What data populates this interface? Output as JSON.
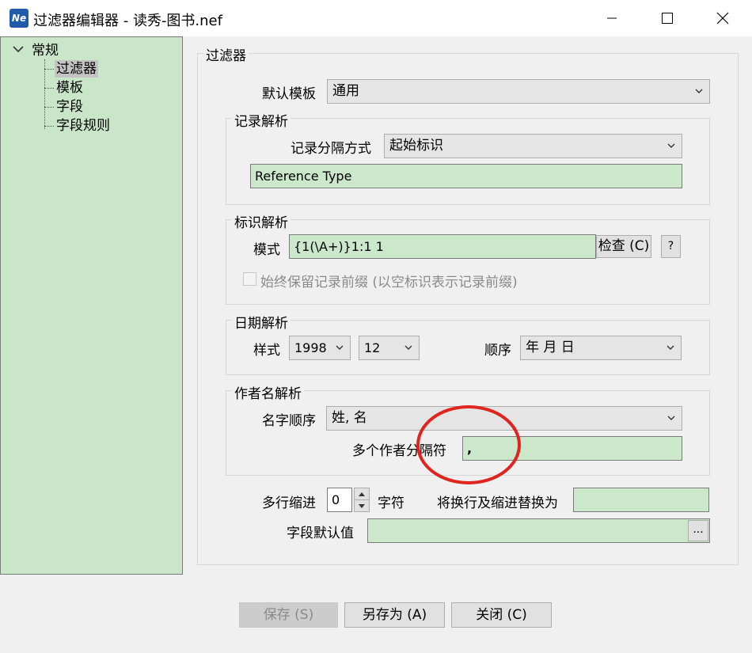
{
  "window": {
    "title": "过滤器编辑器 - 读秀-图书.nef",
    "icon_text": "Ne"
  },
  "tree": {
    "root_label": "常规",
    "items": [
      "过滤器",
      "模板",
      "字段",
      "字段规则"
    ]
  },
  "main": {
    "group_title": "过滤器",
    "default_template": {
      "label": "默认模板",
      "value": "通用"
    },
    "record_parse": {
      "title": "记录解析",
      "separator_label": "记录分隔方式",
      "separator_value": "起始标识",
      "field_value": "Reference Type"
    },
    "tag_parse": {
      "title": "标识解析",
      "mode_label": "模式",
      "mode_value": "{1(\\A+)}1:1 1",
      "check_button": "检查 (C)",
      "help_button": "?",
      "keep_prefix_label": "始终保留记录前缀 (以空标识表示记录前缀)"
    },
    "date_parse": {
      "title": "日期解析",
      "style_label": "样式",
      "year_value": "1998",
      "month_value": "12",
      "order_label": "顺序",
      "order_value": "年 月 日"
    },
    "author_parse": {
      "title": "作者名解析",
      "name_order_label": "名字顺序",
      "name_order_value": "姓, 名",
      "multi_sep_label": "多个作者分隔符",
      "multi_sep_value": ","
    },
    "indent": {
      "label": "多行缩进",
      "value": "0",
      "unit": "字符",
      "replace_label": "将换行及缩进替换为",
      "replace_value": ""
    },
    "field_default": {
      "label": "字段默认值",
      "value": "",
      "browse_label": "..."
    }
  },
  "footer": {
    "save_button": "保存 (S)",
    "save_as_button": "另存为 (A)",
    "close_button": "关闭 (C)"
  },
  "colors": {
    "field_green": "#cbe8cb",
    "tree_green": "#c9e6c9",
    "annotation_red": "#e0241e"
  }
}
